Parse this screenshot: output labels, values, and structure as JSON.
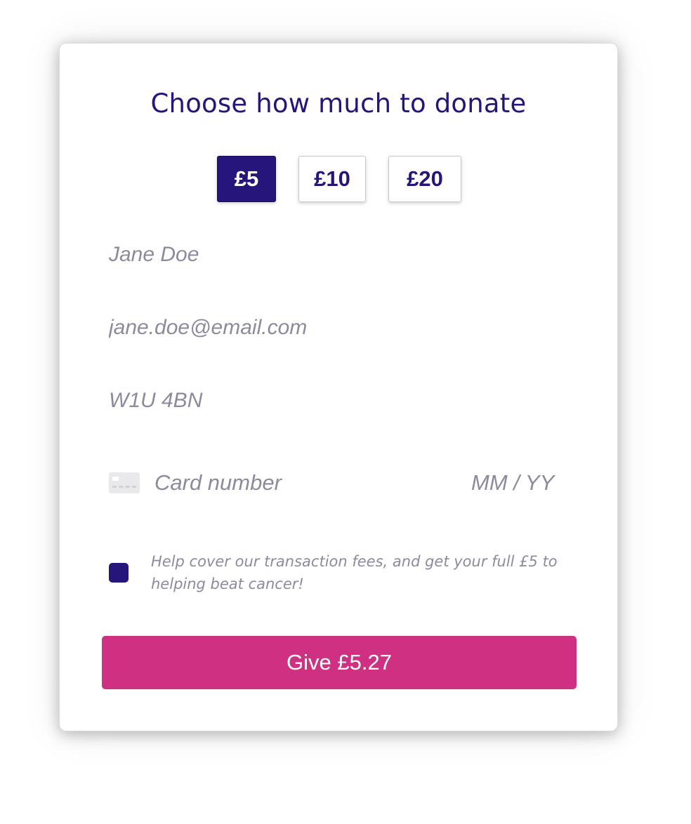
{
  "form": {
    "title": "Choose how much to donate",
    "amounts": [
      {
        "label": "£5",
        "selected": true
      },
      {
        "label": "£10",
        "selected": false
      },
      {
        "label": "£20",
        "selected": false
      }
    ],
    "name_placeholder": "Jane Doe",
    "email_placeholder": "jane.doe@email.com",
    "postcode_placeholder": "W1U 4BN",
    "card": {
      "icon": "credit-card-icon",
      "number_placeholder": "Card number",
      "expiry_placeholder": "MM / YY"
    },
    "fee_checkbox": {
      "checked": true,
      "label": "Help cover our transaction fees, and get your full £5 to helping beat cancer!"
    },
    "submit_label": "Give £5.27"
  },
  "colors": {
    "primary": "#26157a",
    "accent": "#d03081",
    "placeholder": "#8e8a9d"
  }
}
